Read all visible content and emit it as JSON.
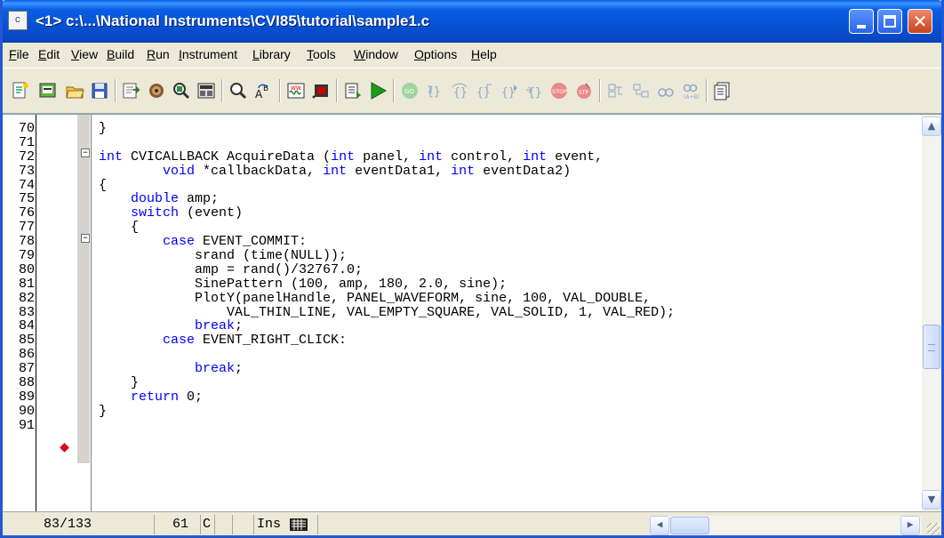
{
  "window": {
    "title": "<1> c:\\...\\National Instruments\\CVI85\\tutorial\\sample1.c",
    "app_icon_text": "c",
    "close_glyph": "✕"
  },
  "menu": [
    {
      "label": "File"
    },
    {
      "label": "Edit"
    },
    {
      "label": "View"
    },
    {
      "label": "Build"
    },
    {
      "label": "Run"
    },
    {
      "label": "Instrument"
    },
    {
      "label": "Library"
    },
    {
      "label": "Tools"
    },
    {
      "label": "Window"
    },
    {
      "label": "Options"
    },
    {
      "label": "Help"
    }
  ],
  "toolbar": [
    {
      "icon": "new-source-icon"
    },
    {
      "icon": "open-panel-icon"
    },
    {
      "icon": "open-file-icon"
    },
    {
      "icon": "save-icon"
    },
    {
      "icon": "include-icon"
    },
    {
      "icon": "set-target-icon"
    },
    {
      "icon": "find-function-icon"
    },
    {
      "icon": "function-panel-icon"
    },
    {
      "icon": "find-icon"
    },
    {
      "icon": "replace-icon"
    },
    {
      "icon": "user-interface-icon"
    },
    {
      "icon": "panel-icon"
    },
    {
      "icon": "build-icon"
    },
    {
      "icon": "run-icon"
    },
    {
      "icon": "go-icon"
    },
    {
      "icon": "step-into-icon"
    },
    {
      "icon": "step-over-icon"
    },
    {
      "icon": "step-out-icon"
    },
    {
      "icon": "continue-icon"
    },
    {
      "icon": "finish-function-icon"
    },
    {
      "icon": "stop-icon"
    },
    {
      "icon": "stop-debug-icon"
    },
    {
      "icon": "toggle-breakpoint-icon"
    },
    {
      "icon": "clear-breakpoint-icon"
    },
    {
      "icon": "watch-icon"
    },
    {
      "icon": "evaluate-icon"
    },
    {
      "icon": "variables-icon"
    }
  ],
  "editor": {
    "line_numbers": [
      "70",
      "71",
      "72",
      "73",
      "74",
      "75",
      "76",
      "77",
      "78",
      "79",
      "80",
      "81",
      "82",
      "83",
      "84",
      "85",
      "86",
      "87",
      "88",
      "89",
      "90",
      "91"
    ],
    "code_lines": [
      [
        {
          "t": "}"
        }
      ],
      [
        {
          "t": ""
        }
      ],
      [
        {
          "t": "int",
          "k": 1
        },
        {
          "t": " CVICALLBACK AcquireData ("
        },
        {
          "t": "int",
          "k": 1
        },
        {
          "t": " panel, "
        },
        {
          "t": "int",
          "k": 1
        },
        {
          "t": " control, "
        },
        {
          "t": "int",
          "k": 1
        },
        {
          "t": " event,"
        }
      ],
      [
        {
          "t": "        "
        },
        {
          "t": "void",
          "k": 1
        },
        {
          "t": " *callbackData, "
        },
        {
          "t": "int",
          "k": 1
        },
        {
          "t": " eventData1, "
        },
        {
          "t": "int",
          "k": 1
        },
        {
          "t": " eventData2)"
        }
      ],
      [
        {
          "t": "{"
        }
      ],
      [
        {
          "t": "    "
        },
        {
          "t": "double",
          "k": 1
        },
        {
          "t": " amp;"
        }
      ],
      [
        {
          "t": "    "
        },
        {
          "t": "switch",
          "k": 1
        },
        {
          "t": " (event)"
        }
      ],
      [
        {
          "t": "    {"
        }
      ],
      [
        {
          "t": "        "
        },
        {
          "t": "case",
          "k": 1
        },
        {
          "t": " EVENT_COMMIT:"
        }
      ],
      [
        {
          "t": "            srand (time(NULL));"
        }
      ],
      [
        {
          "t": "            amp = rand()/32767.0;"
        }
      ],
      [
        {
          "t": "            SinePattern (100, amp, 180, 2.0, sine);"
        }
      ],
      [
        {
          "t": "            PlotY(panelHandle, PANEL_WAVEFORM, sine, 100, VAL_DOUBLE,"
        }
      ],
      [
        {
          "t": "                VAL_THIN_LINE, VAL_EMPTY_SQUARE, VAL_SOLID, 1, VAL_RED);"
        }
      ],
      [
        {
          "t": "            "
        },
        {
          "t": "break",
          "k": 1
        },
        {
          "t": ";"
        }
      ],
      [
        {
          "t": "        "
        },
        {
          "t": "case",
          "k": 1
        },
        {
          "t": " EVENT_RIGHT_CLICK:"
        }
      ],
      [
        {
          "t": ""
        }
      ],
      [
        {
          "t": "            "
        },
        {
          "t": "break",
          "k": 1
        },
        {
          "t": ";"
        }
      ],
      [
        {
          "t": "    }"
        }
      ],
      [
        {
          "t": "    "
        },
        {
          "t": "return",
          "k": 1
        },
        {
          "t": " 0;"
        }
      ],
      [
        {
          "t": "}"
        }
      ],
      [
        {
          "t": ""
        }
      ]
    ],
    "breakpoint_glyph": "◆",
    "fold_glyph": "−"
  },
  "status": {
    "position": "83/133",
    "column": "61",
    "column_flag": "C",
    "mode": "Ins",
    "keyboard_icon": "keyboard-icon",
    "scroll_left": "◀",
    "scroll_right": "▶",
    "scroll_up": "▲",
    "scroll_down": "▼"
  }
}
